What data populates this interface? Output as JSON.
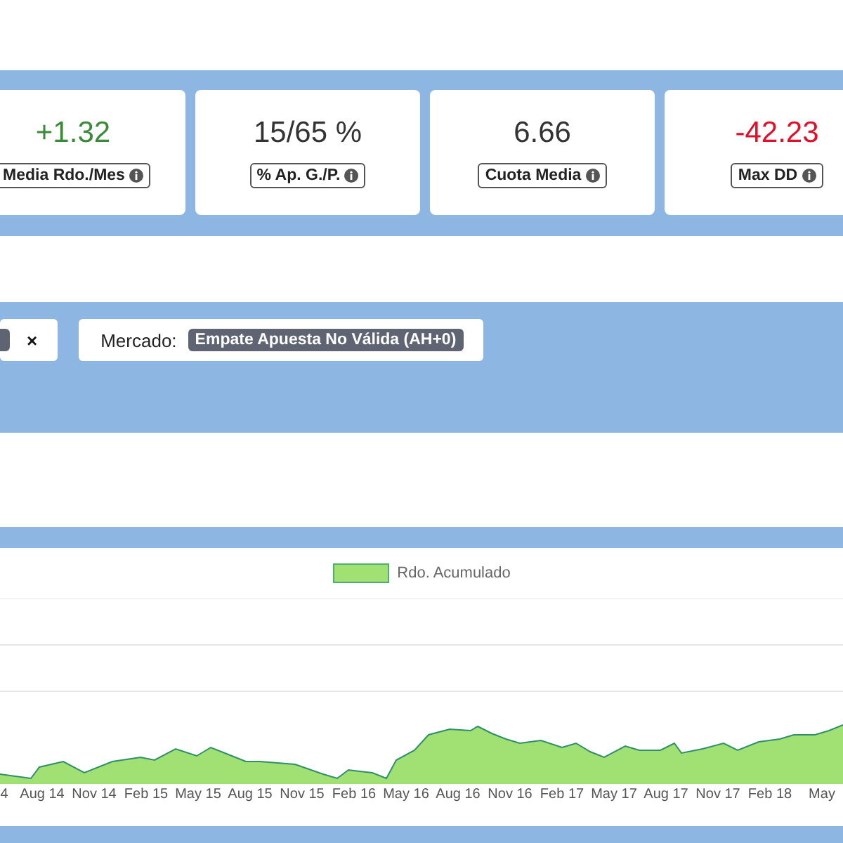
{
  "stats": [
    {
      "value": "+1.32",
      "color": "#3a8a3a",
      "label": "Media Rdo./Mes"
    },
    {
      "value": "15/65 %",
      "color": "#333333",
      "label": "% Ap. G./P."
    },
    {
      "value": "6.66",
      "color": "#333333",
      "label": "Cuota Media"
    },
    {
      "value": "-42.23",
      "color": "#e0102a",
      "label": "Max DD"
    }
  ],
  "filters": [
    {
      "kind": "cut",
      "remove": "×"
    },
    {
      "kind": "full",
      "label": "Mercado:",
      "value": "Empate Apuesta No Válida (AH+0)"
    }
  ],
  "chart": {
    "legend": "Rdo. Acumulado",
    "x_labels": [
      "4",
      "Aug 14",
      "Nov 14",
      "Feb 15",
      "May 15",
      "Aug 15",
      "Nov 15",
      "Feb 16",
      "May 16",
      "Aug 16",
      "Nov 16",
      "Feb 17",
      "May 17",
      "Aug 17",
      "Nov 17",
      "Feb 18",
      "May"
    ]
  }
}
